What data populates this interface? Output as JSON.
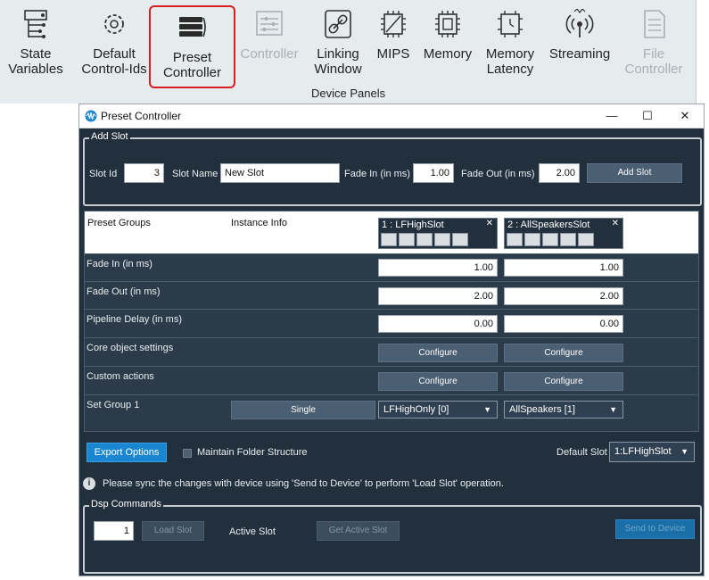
{
  "ribbon": {
    "items": [
      {
        "label": "State\nVariables",
        "icon": "state-variables-icon"
      },
      {
        "label": "Default\nControl-Ids",
        "icon": "gear-puzzle-icon"
      },
      {
        "label": "Preset\nController",
        "icon": "preset-stack-icon"
      },
      {
        "label": "Controller",
        "icon": "controller-icon"
      },
      {
        "label": "Linking\nWindow",
        "icon": "link-icon"
      },
      {
        "label": "MIPS",
        "icon": "chip-icon"
      },
      {
        "label": "Memory",
        "icon": "memory-chip-icon"
      },
      {
        "label": "Memory\nLatency",
        "icon": "memory-latency-icon"
      },
      {
        "label": "Streaming",
        "icon": "streaming-icon"
      },
      {
        "label": "File\nController",
        "icon": "file-controller-icon"
      }
    ],
    "group_label": "Device Panels",
    "accent_color": "#d81e23"
  },
  "window": {
    "title": "Preset Controller",
    "minimize": "—",
    "maximize": "☐",
    "close": "✕"
  },
  "add_slot": {
    "legend": "Add Slot",
    "slot_id_label": "Slot Id",
    "slot_id_value": "3",
    "slot_name_label": "Slot Name",
    "slot_name_value": "New Slot",
    "fade_in_label": "Fade In (in ms)",
    "fade_in_value": "1.00",
    "fade_out_label": "Fade Out (in ms)",
    "fade_out_value": "2.00",
    "add_button": "Add Slot"
  },
  "grid": {
    "header_preset_groups": "Preset Groups",
    "header_instance_info": "Instance Info",
    "slots": [
      {
        "title": "1 : LFHighSlot",
        "close": "✕"
      },
      {
        "title": "2 : AllSpeakersSlot",
        "close": "✕"
      }
    ],
    "rows": {
      "fade_in": {
        "label": "Fade In (in ms)",
        "values": [
          "1.00",
          "1.00"
        ]
      },
      "fade_out": {
        "label": "Fade Out (in ms)",
        "values": [
          "2.00",
          "2.00"
        ]
      },
      "pipeline_delay": {
        "label": "Pipeline Delay (in ms)",
        "values": [
          "0.00",
          "0.00"
        ]
      },
      "core_settings": {
        "label": "Core object settings",
        "buttons": [
          "Configure",
          "Configure"
        ]
      },
      "custom_actions": {
        "label": "Custom actions",
        "buttons": [
          "Configure",
          "Configure"
        ]
      },
      "set_group": {
        "label": "Set Group 1",
        "mode_button": "Single",
        "selects": [
          "LFHighOnly [0]",
          "AllSpeakers [1]"
        ]
      }
    }
  },
  "export": {
    "button": "Export Options",
    "maintain_label": "Maintain Folder Structure",
    "default_slot_label": "Default Slot",
    "default_slot_value": "1:LFHighSlot"
  },
  "info_text": "Please sync the changes with device using 'Send to Device' to perform 'Load Slot' operation.",
  "dsp": {
    "legend": "Dsp Commands",
    "slot_value": "1",
    "load_button": "Load Slot",
    "active_slot_label": "Active Slot",
    "get_active_button": "Get Active Slot",
    "send_button": "Send to Device"
  }
}
